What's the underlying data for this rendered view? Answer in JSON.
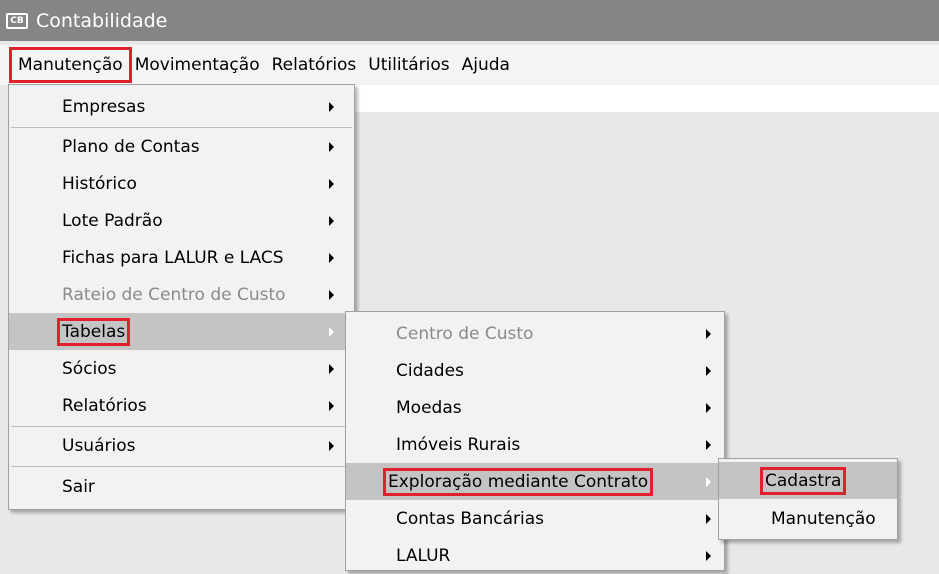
{
  "window": {
    "title": "Contabilidade",
    "icon": "app-window-icon"
  },
  "menubar": {
    "items": [
      "Manutenção",
      "Movimentação",
      "Relatórios",
      "Utilitários",
      "Ajuda"
    ]
  },
  "manutencao_menu": {
    "items": [
      {
        "label": "Empresas",
        "submenu": true
      },
      {
        "label": "Plano de Contas",
        "submenu": true
      },
      {
        "label": "Histórico",
        "submenu": true
      },
      {
        "label": "Lote Padrão",
        "submenu": true
      },
      {
        "label": "Fichas para LALUR e LACS",
        "submenu": true
      },
      {
        "label": "Rateio de Centro de Custo",
        "submenu": true,
        "disabled": true
      },
      {
        "label": "Tabelas",
        "submenu": true,
        "selected": true
      },
      {
        "label": "Sócios",
        "submenu": true
      },
      {
        "label": "Relatórios",
        "submenu": true
      },
      {
        "label": "Usuários",
        "submenu": true
      },
      {
        "label": "Sair",
        "submenu": false
      }
    ]
  },
  "tabelas_menu": {
    "items": [
      {
        "label": "Centro de Custo",
        "submenu": true,
        "disabled": true
      },
      {
        "label": "Cidades",
        "submenu": true
      },
      {
        "label": "Moedas",
        "submenu": true
      },
      {
        "label": "Imóveis Rurais",
        "submenu": true
      },
      {
        "label": "Exploração mediante Contrato",
        "submenu": true,
        "selected": true
      },
      {
        "label": "Contas Bancárias",
        "submenu": true
      },
      {
        "label": "LALUR",
        "submenu": true
      }
    ]
  },
  "exploracao_menu": {
    "items": [
      {
        "label": "Cadastra",
        "selected": true
      },
      {
        "label": "Manutenção"
      }
    ]
  },
  "colors": {
    "highlight_box": "#e0202a",
    "selected_row": "#c4c4c4",
    "titlebar": "#858585"
  }
}
